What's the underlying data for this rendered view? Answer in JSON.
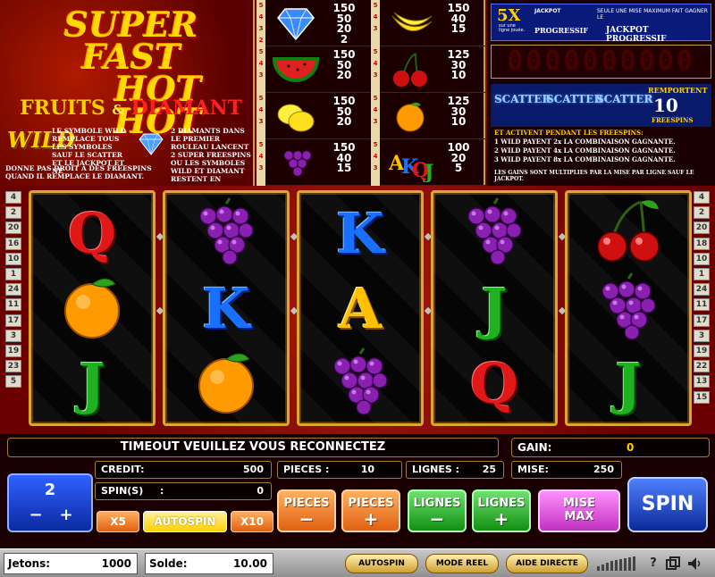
{
  "logo": {
    "title_line1": "SUPER FAST",
    "title_line2": "HOT HOT",
    "sub_fruits": "FRUITS",
    "sub_amp": "&",
    "sub_diamant": "DIAMANT"
  },
  "wild_info": {
    "wild_logo": "WILD",
    "wild_text": "LE SYMBOLE WILD REMPLACE TOUS LES SYMBOLES SAUF LE SCATTER ET LE JACKPOT ET NE",
    "wild_foot": "DONNE PAS DROIT A DES FREESPINS QUAND IL REMPLACE LE DIAMANT.",
    "diamond_text": "2 DIAMANTS DANS LE PREMIER ROULEAU LANCENT 2 SUPER FREESPINS OU LES SYMBOLES WILD ET DIAMANT RESTENT EN"
  },
  "paytable": [
    {
      "symbol": "diamond",
      "counts": [
        "5",
        "4",
        "3",
        "2"
      ],
      "values": [
        "150",
        "50",
        "20",
        "2"
      ]
    },
    {
      "symbol": "bananas",
      "counts": [
        "5",
        "4",
        "3"
      ],
      "values": [
        "150",
        "40",
        "15"
      ]
    },
    {
      "symbol": "watermelon",
      "counts": [
        "5",
        "4",
        "3"
      ],
      "values": [
        "150",
        "50",
        "20"
      ]
    },
    {
      "symbol": "cherries",
      "counts": [
        "5",
        "4",
        "3"
      ],
      "values": [
        "125",
        "30",
        "10"
      ]
    },
    {
      "symbol": "lemons",
      "counts": [
        "5",
        "4",
        "3"
      ],
      "values": [
        "150",
        "50",
        "20"
      ]
    },
    {
      "symbol": "orange",
      "counts": [
        "5",
        "4",
        "3"
      ],
      "values": [
        "125",
        "30",
        "10"
      ]
    },
    {
      "symbol": "grapes",
      "counts": [
        "5",
        "4",
        "3"
      ],
      "values": [
        "150",
        "40",
        "15"
      ]
    },
    {
      "symbol": "AKQJ",
      "counts": [
        "5",
        "4",
        "3"
      ],
      "values": [
        "100",
        "20",
        "5"
      ]
    }
  ],
  "jackpot": {
    "multiplier": "5X",
    "small_note": "sur une ligne jouée.",
    "jackpot_label": "JACKPOT",
    "progressif1": "PROGRESSIF",
    "note": "SEULE UNE MISE MAXIMUM FAIT GAGNER LE",
    "progressif2": "JACKPOT PROGRESSIF",
    "digits": "0000000000",
    "scatter_label": "SCATTER",
    "remportent": "REMPORTENT",
    "freespins_num": "10",
    "freespins_label": "FREESPINS",
    "rules_title": "ET ACTIVENT PENDANT LES FREESPINS:",
    "rule1": "1 WILD PAYENT 2x LA COMBINAISON GAGNANTE.",
    "rule2": "2 WILD PAYENT 4x LA COMBINAISON GAGNANTE.",
    "rule3": "3 WILD PAYENT 8x LA COMBINAISON GAGNANTE.",
    "footnote": "LES GAINS SONT MULTIPLIES PAR LA MISE PAR LIGNE SAUF LE JACKPOT."
  },
  "line_numbers_left": [
    "4",
    "2",
    "20",
    "16",
    "10",
    "1",
    "24",
    "11",
    "17",
    "3",
    "19",
    "23",
    "5"
  ],
  "line_numbers_right": [
    "4",
    "2",
    "20",
    "18",
    "10",
    "1",
    "24",
    "11",
    "17",
    "3",
    "19",
    "22",
    "13",
    "15"
  ],
  "reels": [
    [
      "Q",
      "orange",
      "J"
    ],
    [
      "grapes",
      "K",
      "orange"
    ],
    [
      "K",
      "A",
      "grapes"
    ],
    [
      "grapes",
      "J",
      "Q"
    ],
    [
      "cherries",
      "grapes",
      "J"
    ]
  ],
  "status": {
    "message": "TIMEOUT VEUILLEZ VOUS RECONNECTEZ",
    "gain_label": "GAIN:",
    "gain_value": "0",
    "credit_label": "CREDIT:",
    "credit_value": "500",
    "spins_label": "SPIN(S)",
    "spins_colon": ":",
    "spins_value": "0",
    "pieces_label": "PIECES :",
    "pieces_value": "10",
    "lignes_label": "LIGNES :",
    "lignes_value": "25",
    "mise_label": "MISE:",
    "mise_value": "250"
  },
  "controls": {
    "lines_value": "2",
    "minus": "−",
    "plus": "+",
    "x5": "X5",
    "autospin": "AUTOSPIN",
    "x10": "X10",
    "pieces": "PIECES",
    "lignes": "LIGNES",
    "mise": "MISE",
    "max": "MAX",
    "spin": "SPIN"
  },
  "footer": {
    "jetons_label": "Jetons:",
    "jetons_value": "1000",
    "solde_label": "Solde:",
    "solde_value": "10.00",
    "autospin": "AUTOSPIN",
    "mode_reel": "MODE REEL",
    "aide": "AIDE DIRECTE",
    "help_icon": "?"
  },
  "colors": {
    "gold": "#d8a830",
    "red_bg": "#8b0a0a",
    "blue_button": "#0a2a9a"
  }
}
